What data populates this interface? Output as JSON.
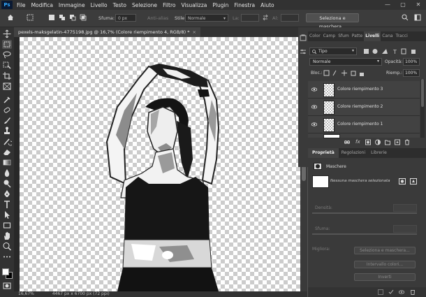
{
  "app": {
    "logo": "Ps",
    "menu": [
      "File",
      "Modifica",
      "Immagine",
      "Livello",
      "Testo",
      "Selezione",
      "Filtro",
      "Visualizza",
      "Plugin",
      "Finestra",
      "Aiuto"
    ],
    "window_controls": [
      "—",
      "▢",
      "✕"
    ]
  },
  "options_bar": {
    "feather_label": "Sfuma:",
    "feather_value": "0 px",
    "antialias_label": "Anti-alias",
    "style_label": "Stile:",
    "style_value": "Normale",
    "width_label": "La:",
    "height_label": "Al:",
    "select_mask_button": "Seleziona e maschera..."
  },
  "document": {
    "tab_title": "pexels-maksgelatin-4775198.jpg @ 16,7% (Colore riempimento 4, RGB/8) *",
    "close": "×",
    "zoom": "16,67%",
    "dimensions": "4467 px x 6700 px (72 ppi)"
  },
  "top_panel": {
    "tabs": [
      "Color",
      "Camp",
      "Sfum",
      "Patte",
      "Livelli",
      "Cana",
      "Tracci"
    ],
    "active_tab": "Livelli",
    "filter_kind": "Tipo",
    "blend_mode": "Normale",
    "opacity_label": "Opacità:",
    "opacity_value": "100%",
    "lock_label": "Bloc.:",
    "fill_label": "Riemp.:",
    "fill_value": "100%",
    "layers": [
      {
        "name": "Colore riempimento 3"
      },
      {
        "name": "Colore riempimento 2"
      },
      {
        "name": "Colore riempimento 1"
      }
    ],
    "fx_label": "fx"
  },
  "properties_panel": {
    "tabs": [
      "Proprietà",
      "Regolazioni",
      "Librerie"
    ],
    "active_tab": "Proprietà",
    "masks_label": "Maschere",
    "no_mask": "Nessuna maschera selezionata",
    "density_label": "Densità:",
    "feather_label": "Sfuma:",
    "refine_label": "Migliora:",
    "select_mask_button": "Seleziona e maschera...",
    "color_range_button": "Intervallo colori...",
    "invert_button": "Inverti"
  },
  "colors": {
    "ui_dark": "#323232",
    "ui_panel": "#3a3a3a",
    "accent": "#31a8ff"
  }
}
